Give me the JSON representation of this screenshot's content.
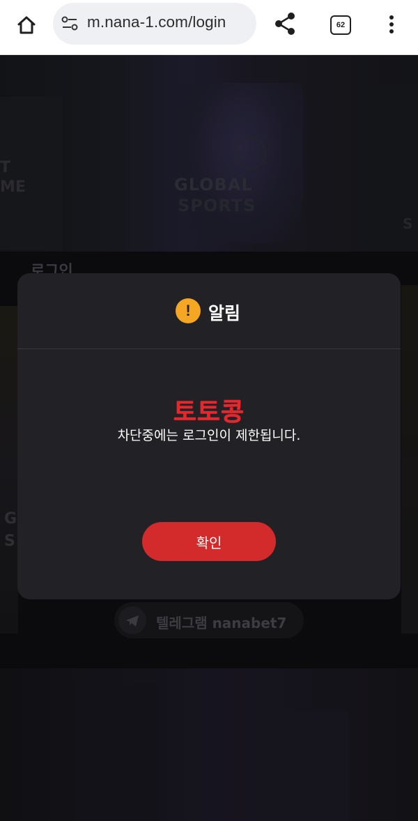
{
  "browser": {
    "url": "m.nana-1.com/login",
    "tab_count": "62",
    "icons": [
      "home-icon",
      "site-settings-icon",
      "share-icon",
      "tab-switcher-icon",
      "overflow-menu-icon"
    ]
  },
  "background": {
    "banner_text_line1": "GLOBAL",
    "banner_text_line2": "SPORTS",
    "edge_left_text": "T\nME",
    "edge_right_text": "S",
    "login_heading": "로그인",
    "side_text": "G\nS",
    "telegram_label": "텔레그램 nanabet7"
  },
  "modal": {
    "title": "알림",
    "alert_icon_glyph": "!",
    "brand_text": "토토콩",
    "message": "차단중에는 로그인이 제한됩니다.",
    "confirm_label": "확인"
  },
  "colors": {
    "modal_bg": "#222125",
    "accent_red": "#d32b2b",
    "brand_red": "#e8262b",
    "alert_orange": "#f5a623"
  }
}
